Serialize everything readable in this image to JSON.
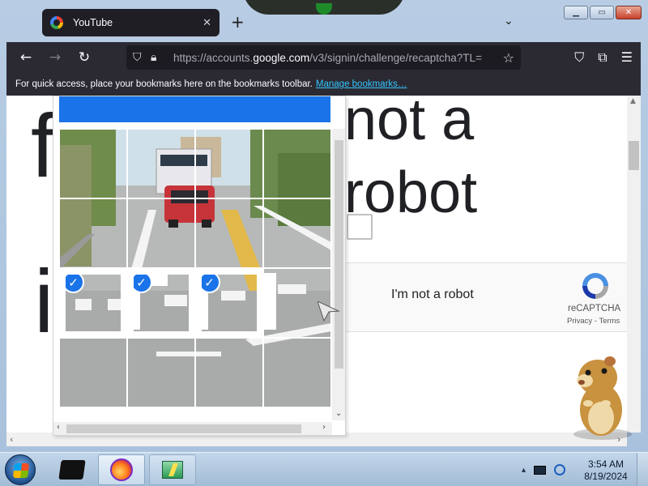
{
  "browser": {
    "tab": {
      "title": "YouTube",
      "favicon": "google-g-icon"
    },
    "url": {
      "prefix": "https://accounts.",
      "domain": "google.com",
      "path": "/v3/signin/challenge/recaptcha?TL="
    },
    "bookmarks_bar": {
      "message": "For quick access, place your bookmarks here on the bookmarks toolbar.",
      "link": "Manage bookmarks…"
    }
  },
  "page": {
    "heading_line1": "not a",
    "heading_line2": "robot",
    "left_glyph_top": "f",
    "left_glyph_bottom": "i"
  },
  "recaptcha_widget": {
    "label": "I'm not a robot",
    "brand": "reCAPTCHA",
    "privacy": "Privacy",
    "separator": "-",
    "terms": "Terms",
    "checked": false
  },
  "challenge": {
    "header_color": "#1a73e8",
    "grid_rows": 4,
    "grid_cols": 4,
    "selected_tiles": [
      8,
      9,
      10
    ]
  },
  "taskbar": {
    "time": "3:54 AM",
    "date": "8/19/2024"
  },
  "colors": {
    "accent": "#1a73e8",
    "toolbar": "#2b2a33",
    "link": "#33c6ff"
  }
}
